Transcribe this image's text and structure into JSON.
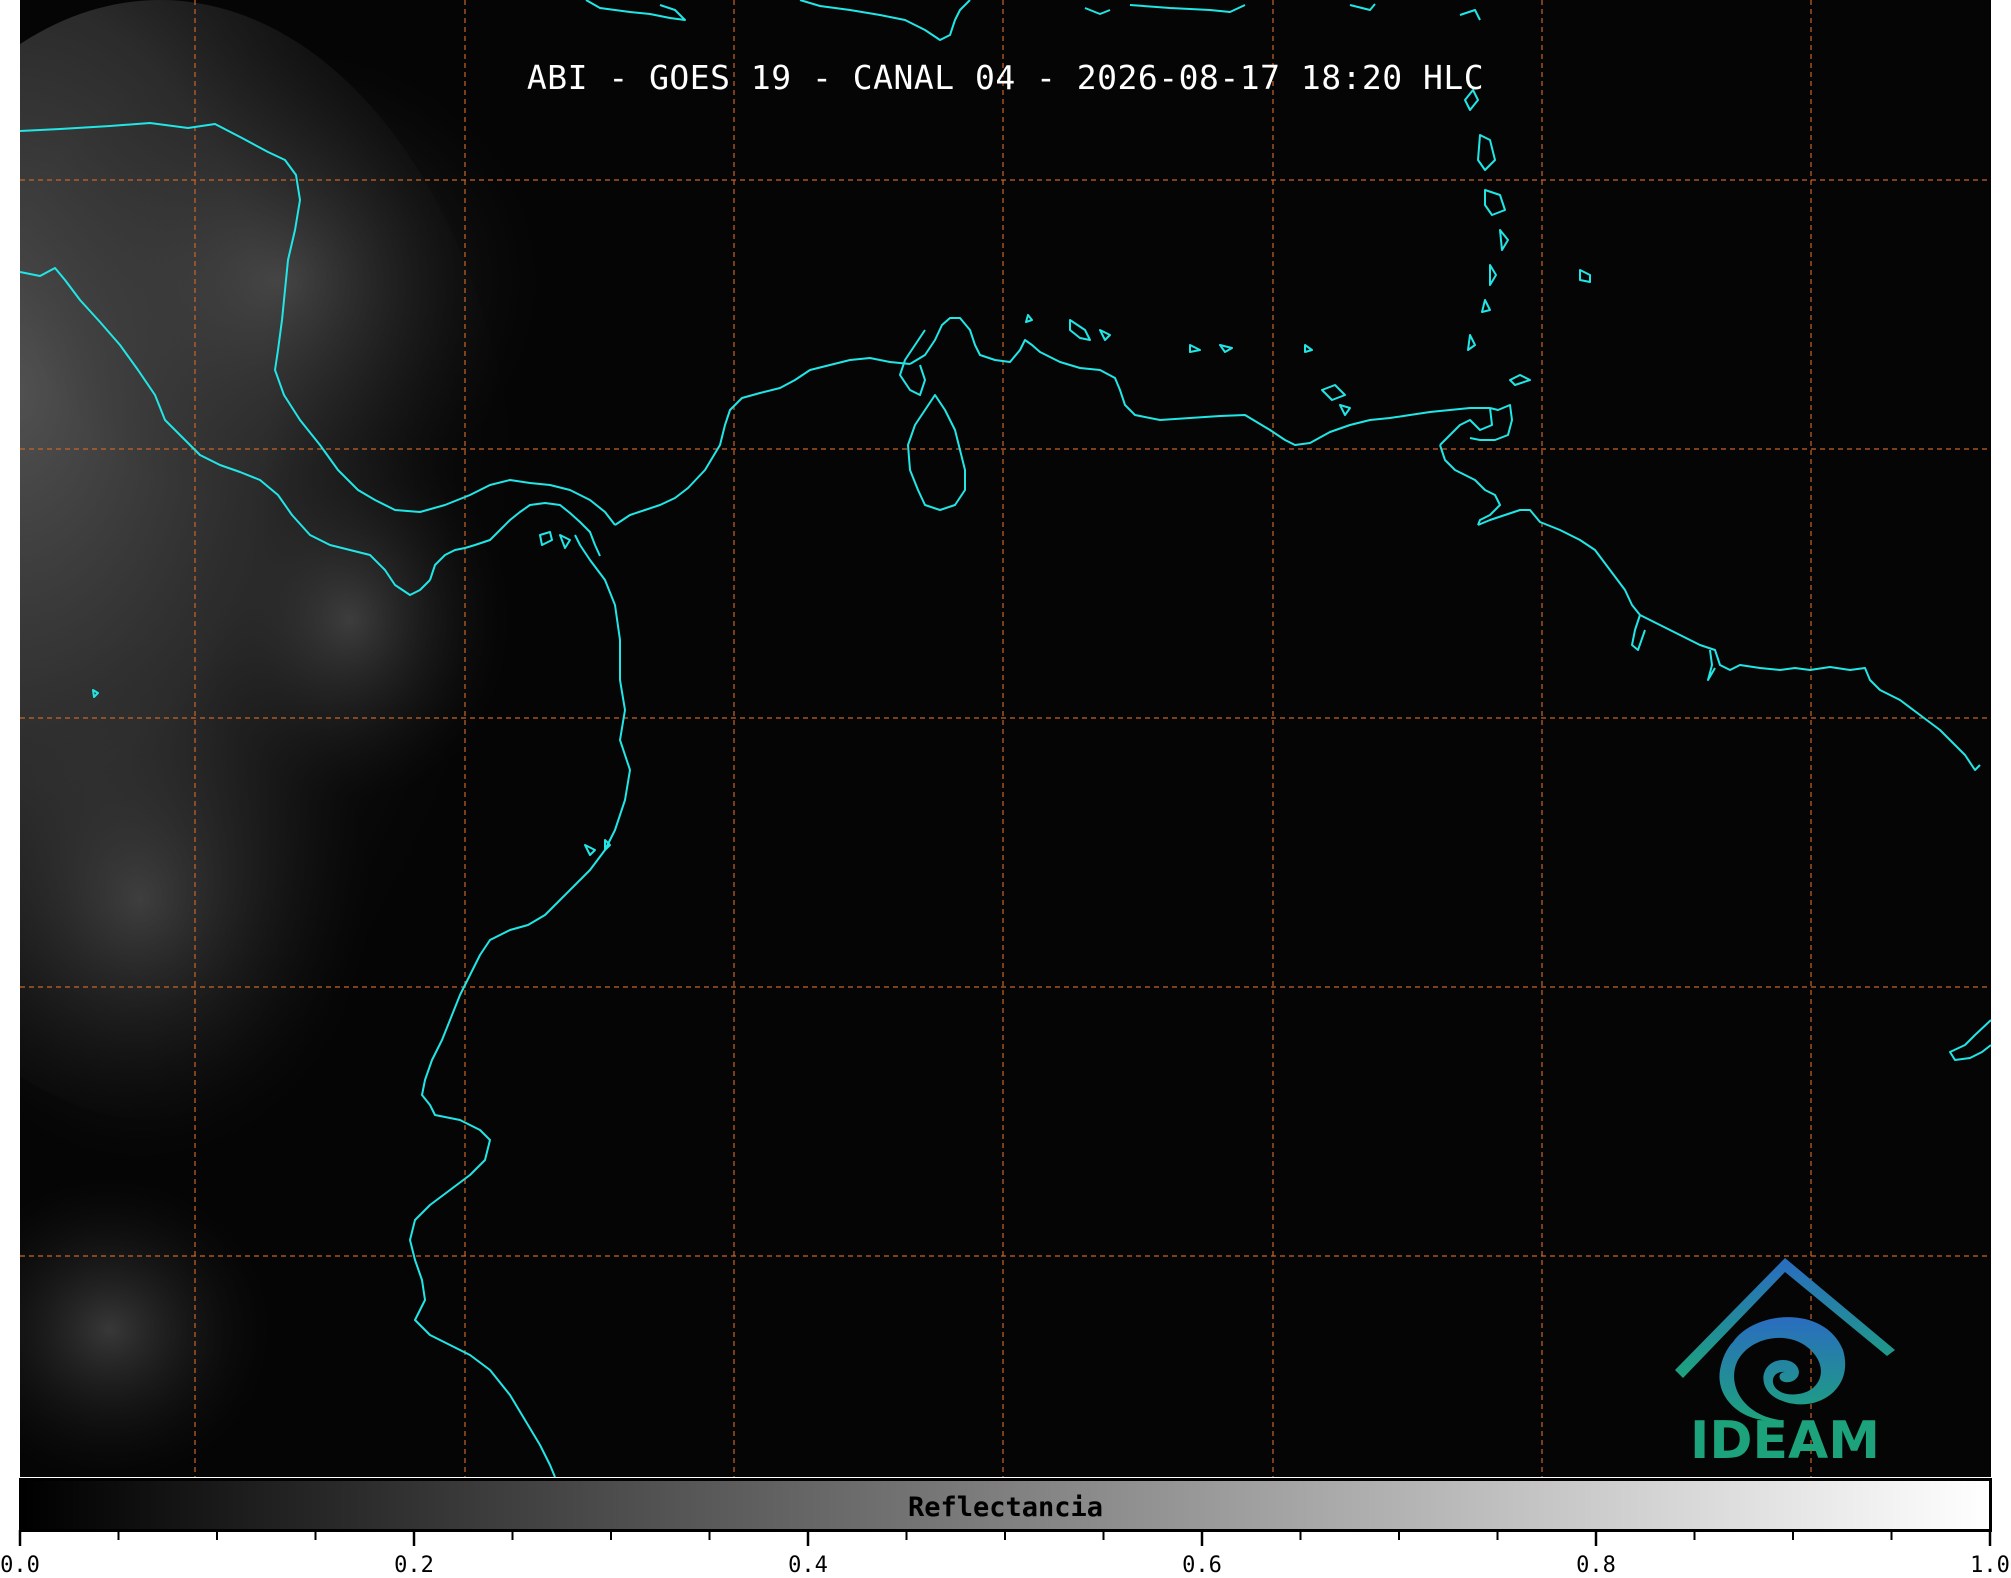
{
  "map": {
    "title": "ABI - GOES 19 - CANAL 04 - 2026-08-17 18:20 HLC",
    "background_color": "#050505",
    "coastline_color": "#22e6e6",
    "grid_color": "#c8652a",
    "grid_style": "dashed"
  },
  "logo": {
    "icon": "ideam-mountain-spiral-icon",
    "text": "IDEAM",
    "color": "#1da37c"
  },
  "colorbar": {
    "label": "Reflectancia",
    "colormap": "grayscale",
    "range": [
      0.0,
      1.0
    ],
    "tick_labels": [
      "0.0",
      "0.2",
      "0.4",
      "0.6",
      "0.8",
      "1.0"
    ],
    "minor_tick_step": 0.05
  }
}
